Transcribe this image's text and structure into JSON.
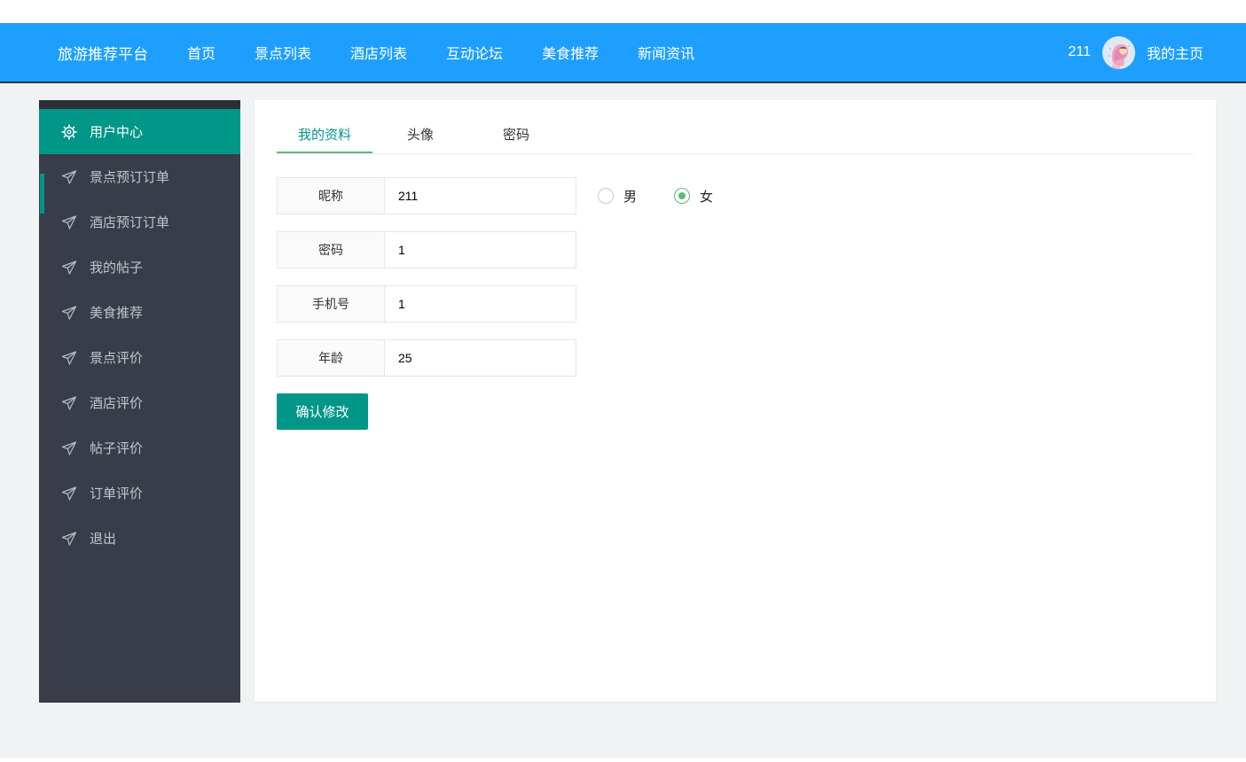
{
  "navbar": {
    "brand": "旅游推荐平台",
    "items": [
      {
        "label": "首页"
      },
      {
        "label": "景点列表"
      },
      {
        "label": "酒店列表"
      },
      {
        "label": "互动论坛"
      },
      {
        "label": "美食推荐"
      },
      {
        "label": "新闻资讯"
      }
    ],
    "username": "211",
    "avatar_icon": "user-avatar",
    "profile_link": "我的主页"
  },
  "sidebar": {
    "items": [
      {
        "label": "用户中心",
        "icon": "gear-icon",
        "active": true
      },
      {
        "label": "景点预订订单",
        "icon": "paper-plane-icon"
      },
      {
        "label": "酒店预订订单",
        "icon": "paper-plane-icon"
      },
      {
        "label": "我的帖子",
        "icon": "paper-plane-icon"
      },
      {
        "label": "美食推荐",
        "icon": "paper-plane-icon"
      },
      {
        "label": "景点评价",
        "icon": "paper-plane-icon"
      },
      {
        "label": "酒店评价",
        "icon": "paper-plane-icon"
      },
      {
        "label": "帖子评价",
        "icon": "paper-plane-icon"
      },
      {
        "label": "订单评价",
        "icon": "paper-plane-icon"
      },
      {
        "label": "退出",
        "icon": "paper-plane-icon"
      }
    ]
  },
  "main": {
    "tabs": [
      {
        "label": "我的资料",
        "active": true
      },
      {
        "label": "头像",
        "active": false
      },
      {
        "label": "密码",
        "active": false
      }
    ],
    "form": {
      "rows": [
        {
          "label": "昵称",
          "value": "211"
        },
        {
          "label": "密码",
          "value": "1"
        },
        {
          "label": "手机号",
          "value": "1"
        },
        {
          "label": "年龄",
          "value": "25"
        }
      ],
      "gender": {
        "options": [
          {
            "label": "男",
            "checked": false
          },
          {
            "label": "女",
            "checked": true
          }
        ]
      },
      "submit_label": "确认修改"
    }
  },
  "colors": {
    "navbar_blue": "#1E9FFF",
    "navbar_border": "#2b3949",
    "sidebar_dark": "#393D49",
    "accent_teal": "#009688",
    "radio_green": "#5FB878",
    "tab_underline_green": "#5FB878",
    "page_background": "#f1f2f3"
  }
}
